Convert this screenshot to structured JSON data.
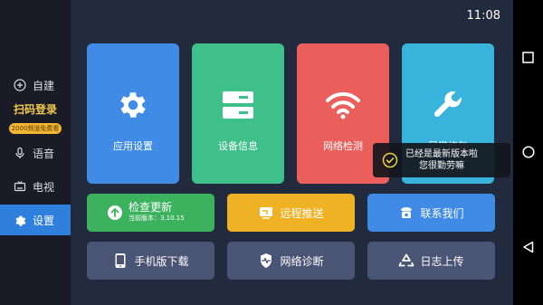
{
  "status_bar": {
    "time": "11:08"
  },
  "sidebar": {
    "items": [
      {
        "label": "自建",
        "icon": "plus-circle-icon"
      },
      {
        "label": "语音",
        "icon": "microphone-icon"
      },
      {
        "label": "电视",
        "icon": "tv-icon"
      },
      {
        "label": "设置",
        "icon": "gear-icon",
        "active": true
      }
    ],
    "promo": {
      "title": "扫码登录",
      "badge": "2000频道免费看"
    }
  },
  "cards": [
    {
      "label": "应用设置",
      "icon": "gear-icon",
      "color": "#3f8be6"
    },
    {
      "label": "设备信息",
      "icon": "storage-icon",
      "color": "#3fbf8a"
    },
    {
      "label": "网络检测",
      "icon": "wifi-icon",
      "color": "#ea5f5c"
    },
    {
      "label": "异常修复",
      "icon": "wrench-icon",
      "color": "#38b4dc"
    }
  ],
  "buttons": {
    "check_update": {
      "label": "检查更新",
      "sub": "当前版本：3.10.15",
      "icon": "arrow-up-icon",
      "color": "#3db25e"
    },
    "remote_push": {
      "label": "远程推送",
      "icon": "cast-icon",
      "color": "#f0b225"
    },
    "contact": {
      "label": "联系我们",
      "icon": "phone-icon",
      "color": "#3f8be6"
    },
    "mobile_download": {
      "label": "手机版下载",
      "icon": "phone-device-icon",
      "color": "#4a5474"
    },
    "network_diag": {
      "label": "网络诊断",
      "icon": "shield-pulse-icon",
      "color": "#4a5474"
    },
    "log_upload": {
      "label": "日志上传",
      "icon": "recycle-icon",
      "color": "#4a5474"
    }
  },
  "toast": {
    "line1": "已经是最新版本啦",
    "line2": "您很勤劳嘛",
    "icon": "check-circle-icon"
  },
  "nav": {
    "icons": [
      "square-icon",
      "circle-icon",
      "back-triangle-icon"
    ]
  }
}
